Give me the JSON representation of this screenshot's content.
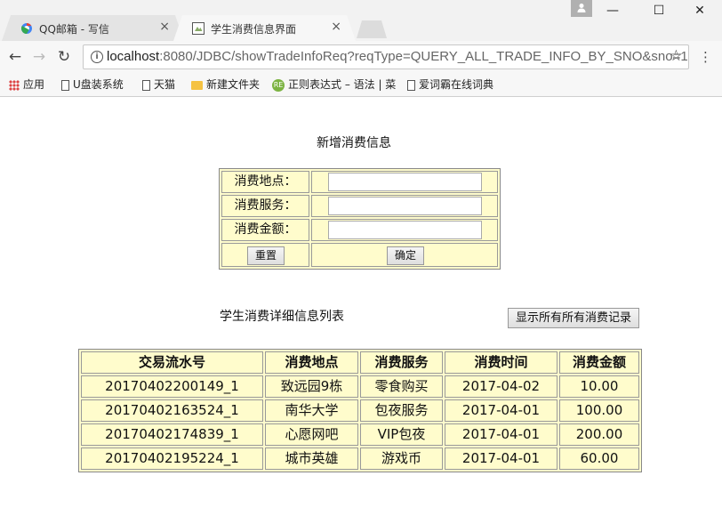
{
  "browser": {
    "tabs": [
      {
        "title": "QQ邮箱 - 写信",
        "close": "×"
      },
      {
        "title": "学生消费信息界面",
        "close": "×"
      }
    ],
    "window_controls": {
      "minimize": "—",
      "maximize": "☐",
      "close": "✕"
    },
    "url": {
      "host": "localhost",
      "rest": ":8080/JDBC/showTradeInfoReq?reqType=QUERY_ALL_TRADE_INFO_BY_SNO&sno=1"
    },
    "bookmarks": [
      "应用",
      "U盘装系统",
      "天猫",
      "新建文件夹",
      "正则表达式 – 语法 | 菜",
      "爱词霸在线词典"
    ]
  },
  "form": {
    "heading": "新增消费信息",
    "fields": [
      {
        "label": "消费地点：",
        "value": ""
      },
      {
        "label": "消费服务：",
        "value": ""
      },
      {
        "label": "消费金额：",
        "value": ""
      }
    ],
    "reset_label": "重置",
    "submit_label": "确定"
  },
  "list": {
    "heading": "学生消费详细信息列表",
    "show_all_label": "显示所有所有消费记录",
    "columns": [
      "交易流水号",
      "消费地点",
      "消费服务",
      "消费时间",
      "消费金额"
    ],
    "rows": [
      [
        "20170402200149_1",
        "致远园9栋",
        "零食购买",
        "2017-04-02",
        "10.00"
      ],
      [
        "20170402163524_1",
        "南华大学",
        "包夜服务",
        "2017-04-01",
        "100.00"
      ],
      [
        "20170402174839_1",
        "心愿网吧",
        "VIP包夜",
        "2017-04-01",
        "200.00"
      ],
      [
        "20170402195224_1",
        "城市英雄",
        "游戏币",
        "2017-04-01",
        "60.00"
      ]
    ]
  }
}
